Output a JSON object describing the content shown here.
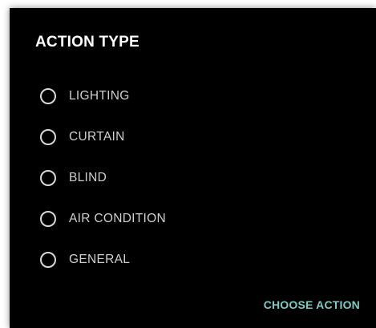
{
  "dialog": {
    "title": "ACTION TYPE",
    "options": [
      {
        "label": "LIGHTING",
        "selected": false
      },
      {
        "label": "CURTAIN",
        "selected": false
      },
      {
        "label": "BLIND",
        "selected": false
      },
      {
        "label": "AIR CONDITION",
        "selected": false
      },
      {
        "label": "GENERAL",
        "selected": false
      }
    ],
    "action_label": "CHOOSE ACTION"
  },
  "colors": {
    "background": "#000000",
    "title": "#ffffff",
    "option_text": "#cfcfcf",
    "radio_border": "#d8d8d8",
    "accent": "#80cbc4"
  }
}
